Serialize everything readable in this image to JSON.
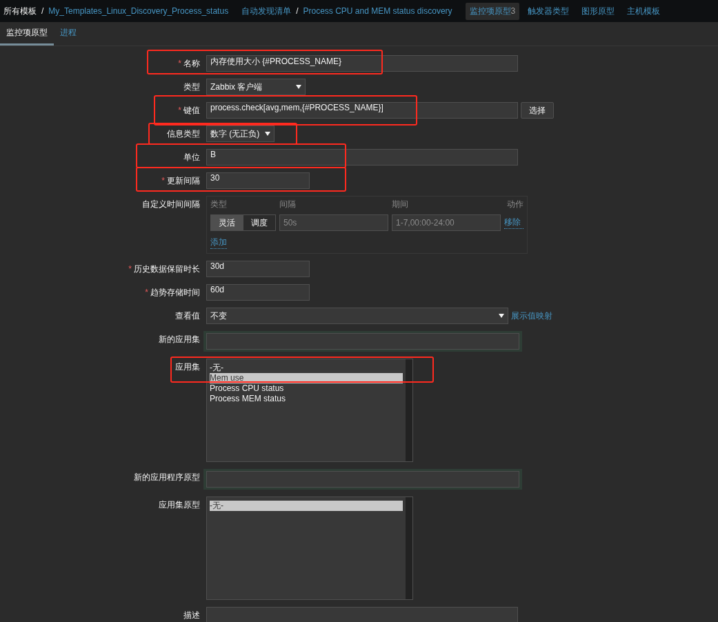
{
  "breadcrumbs": [
    {
      "items": [
        "所有模板",
        "My_Templates_Linux_Discovery_Process_status"
      ],
      "separator": "/"
    },
    {
      "items": [
        "自动发现清单",
        "Process CPU and MEM status discovery"
      ],
      "separator": "/"
    }
  ],
  "nav_tabs": [
    {
      "label": "监控项原型",
      "count": "3",
      "selected": true
    },
    {
      "label": "触发器类型",
      "selected": false
    },
    {
      "label": "图形原型",
      "selected": false
    },
    {
      "label": "主机模板",
      "selected": false
    }
  ],
  "sub_tabs": [
    {
      "label": "监控项原型",
      "selected": true
    },
    {
      "label": "进程",
      "selected": false
    }
  ],
  "form": [
    {
      "kind": "text",
      "label": "名称",
      "required_mark": "*",
      "value": "内存使用大小 {#PROCESS_NAME}",
      "highlighted": true
    },
    {
      "kind": "select",
      "label": "类型",
      "value": "Zabbix 客户端"
    },
    {
      "kind": "key",
      "label": "键值",
      "required_mark": "*",
      "value": "process.check[avg,mem,{#PROCESS_NAME}]",
      "button": "选择",
      "highlighted": true
    },
    {
      "kind": "select",
      "label": "信息类型",
      "value": "数字 (无正负)",
      "highlighted": true
    },
    {
      "kind": "text",
      "label": "单位",
      "value": "B",
      "highlighted": true
    },
    {
      "kind": "text",
      "label": "更新间隔",
      "required_mark": "*",
      "value": "30",
      "highlighted": true
    },
    {
      "kind": "intervals",
      "label": "自定义时间间隔",
      "columns": [
        "类型",
        "间隔",
        "期间",
        "动作"
      ],
      "rows": [
        {
          "modes": [
            {
              "label": "灵活",
              "selected": true
            },
            {
              "label": "调度",
              "selected": false
            }
          ],
          "interval_placeholder": "50s",
          "period_placeholder": "1-7,00:00-24:00",
          "remove": "移除"
        }
      ],
      "add": "添加"
    },
    {
      "kind": "text",
      "label": "历史数据保留时长",
      "required_mark": "*",
      "value": "30d"
    },
    {
      "kind": "text",
      "label": "趋势存储时间",
      "required_mark": "*",
      "value": "60d"
    },
    {
      "kind": "select",
      "label": "查看值",
      "value": "不变",
      "link": "展示值映射"
    },
    {
      "kind": "new_input",
      "label": "新的应用集"
    },
    {
      "kind": "listbox",
      "label": "应用集",
      "items": [
        {
          "label": "-无-",
          "selected": false
        },
        {
          "label": "Mem use",
          "selected": true
        },
        {
          "label": "Process CPU status",
          "selected": false
        },
        {
          "label": "Process MEM status",
          "selected": false
        }
      ],
      "highlighted": true
    },
    {
      "kind": "new_input",
      "label": "新的应用程序原型"
    },
    {
      "kind": "listbox",
      "label": "应用集原型",
      "items": [
        {
          "label": "-无-",
          "selected": true
        }
      ]
    },
    {
      "kind": "textarea",
      "label": "描述"
    }
  ]
}
